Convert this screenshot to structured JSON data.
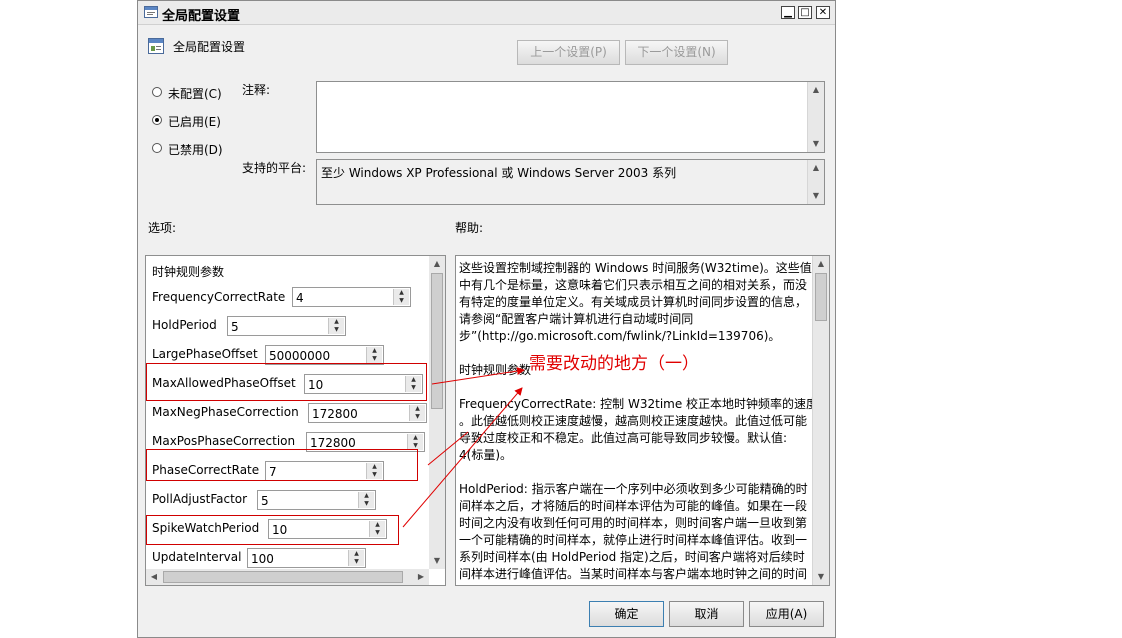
{
  "window": {
    "title": "全局配置设置",
    "controls": {
      "minimize": "▁",
      "maximize": "□",
      "close": "✕"
    }
  },
  "header": {
    "setting_name": "全局配置设置",
    "prev_button": "上一个设置(P)",
    "next_button": "下一个设置(N)"
  },
  "state": {
    "options": [
      {
        "label": "未配置(C)",
        "checked": false
      },
      {
        "label": "已启用(E)",
        "checked": true
      },
      {
        "label": "已禁用(D)",
        "checked": false
      }
    ]
  },
  "comment": {
    "label": "注释:",
    "value": ""
  },
  "platform": {
    "label": "支持的平台:",
    "value": "至少 Windows XP Professional 或 Windows Server 2003 系列"
  },
  "options_panel": {
    "label": "选项:",
    "group_title": "时钟规则参数",
    "params": [
      {
        "name": "FrequencyCorrectRate",
        "value": "4"
      },
      {
        "name": "HoldPeriod",
        "value": "5"
      },
      {
        "name": "LargePhaseOffset",
        "value": "50000000"
      },
      {
        "name": "MaxAllowedPhaseOffset",
        "value": "10"
      },
      {
        "name": "MaxNegPhaseCorrection",
        "value": "172800"
      },
      {
        "name": "MaxPosPhaseCorrection",
        "value": "172800"
      },
      {
        "name": "PhaseCorrectRate",
        "value": "7"
      },
      {
        "name": "PollAdjustFactor",
        "value": "5"
      },
      {
        "name": "SpikeWatchPeriod",
        "value": "10"
      },
      {
        "name": "UpdateInterval",
        "value": "100"
      }
    ]
  },
  "help_panel": {
    "label": "帮助:",
    "lines": [
      "这些设置控制域控制器的 Windows 时间服务(W32time)。这些值",
      "中有几个是标量，这意味着它们只表示相互之间的相对关系，而没",
      "有特定的度量单位定义。有关域成员计算机时间同步设置的信息，",
      "请参阅“配置客户端计算机进行自动域时间同",
      "步”(http://go.microsoft.com/fwlink/?LinkId=139706)。",
      "",
      "时钟规则参数",
      "",
      "FrequencyCorrectRate: 控制 W32time 校正本地时钟频率的速度",
      "。此值越低则校正速度越慢，越高则校正速度越快。此值过低可能",
      "导致过度校正和不稳定。此值过高可能导致同步较慢。默认值:",
      "4(标量)。",
      "",
      "HoldPeriod: 指示客户端在一个序列中必须收到多少可能精确的时",
      "间样本之后，才将随后的时间样本评估为可能的峰值。如果在一段",
      "时间之内没有收到任何可用的时间样本，则时间客户端一旦收到第",
      "一个可能精确的时间样本，就停止进行时间样本峰值评估。收到一",
      "系列时间样本(由 HoldPeriod 指定)之后，时间客户端将对后续时",
      "间样本进行峰值评估。当某时间样本与客户端本地时钟之间的时间"
    ]
  },
  "annotation": {
    "text": "需要改动的地方（一）",
    "color": "#e00000"
  },
  "footer": {
    "ok": "确定",
    "cancel": "取消",
    "apply": "应用(A)"
  }
}
